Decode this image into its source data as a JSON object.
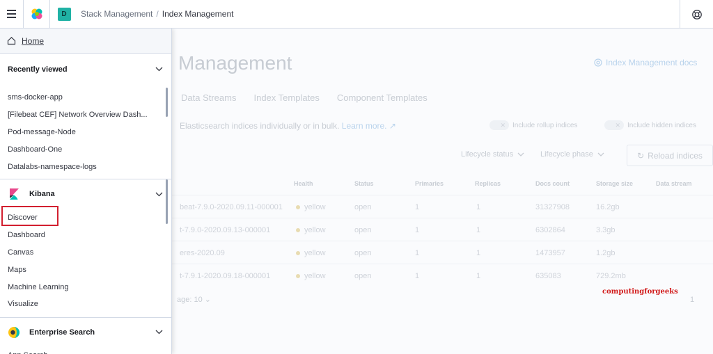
{
  "header": {
    "breadcrumbs": [
      "Stack Management",
      "Index Management"
    ],
    "space_initial": "D",
    "icons": {
      "menu": "hamburger-icon",
      "logo": "elastic-logo-icon",
      "help": "help-lifebuoy-icon"
    }
  },
  "nav": {
    "home_label": "Home",
    "recently_viewed": {
      "title": "Recently viewed",
      "items": [
        "sms-docker-app",
        "[Filebeat CEF] Network Overview Dash...",
        "Pod-message-Node",
        "Dashboard-One",
        "Datalabs-namespace-logs"
      ]
    },
    "kibana": {
      "title": "Kibana",
      "items": [
        "Discover",
        "Dashboard",
        "Canvas",
        "Maps",
        "Machine Learning",
        "Visualize"
      ]
    },
    "enterprise_search": {
      "title": "Enterprise Search",
      "items": [
        "App Search"
      ]
    }
  },
  "main": {
    "title": "Management",
    "docs_link": "Index Management docs",
    "tabs": [
      "Data Streams",
      "Index Templates",
      "Component Templates"
    ],
    "description": "Elasticsearch indices individually or in bulk.",
    "learn_more": "Learn more.",
    "toggles": [
      "Include rollup indices",
      "Include hidden indices"
    ],
    "toggle_mark": "✕",
    "filters": [
      "Lifecycle status",
      "Lifecycle phase"
    ],
    "reload_label": "Reload indices",
    "table": {
      "headers": [
        "Health",
        "Status",
        "Primaries",
        "Replicas",
        "Docs count",
        "Storage size",
        "Data stream"
      ],
      "rows": [
        {
          "name": "beat-7.9.0-2020.09.11-000001",
          "health": "yellow",
          "status": "open",
          "primaries": "1",
          "replicas": "1",
          "docs": "31327908",
          "size": "16.2gb"
        },
        {
          "name": "t-7.9.0-2020.09.13-000001",
          "health": "yellow",
          "status": "open",
          "primaries": "1",
          "replicas": "1",
          "docs": "6302864",
          "size": "3.3gb"
        },
        {
          "name": "eres-2020.09",
          "health": "yellow",
          "status": "open",
          "primaries": "1",
          "replicas": "1",
          "docs": "1473957",
          "size": "1.2gb"
        },
        {
          "name": "t-7.9.1-2020.09.18-000001",
          "health": "yellow",
          "status": "open",
          "primaries": "1",
          "replicas": "1",
          "docs": "635083",
          "size": "729.2mb"
        }
      ]
    },
    "rows_per_page": "age: 10",
    "page_number": "1",
    "watermark": "computingforgeeks"
  },
  "colors": {
    "kibana_pink": "#e8478b",
    "kibana_teal": "#00bfb3",
    "space_badge": "#20b2a5",
    "highlight": "#d21f2f"
  }
}
